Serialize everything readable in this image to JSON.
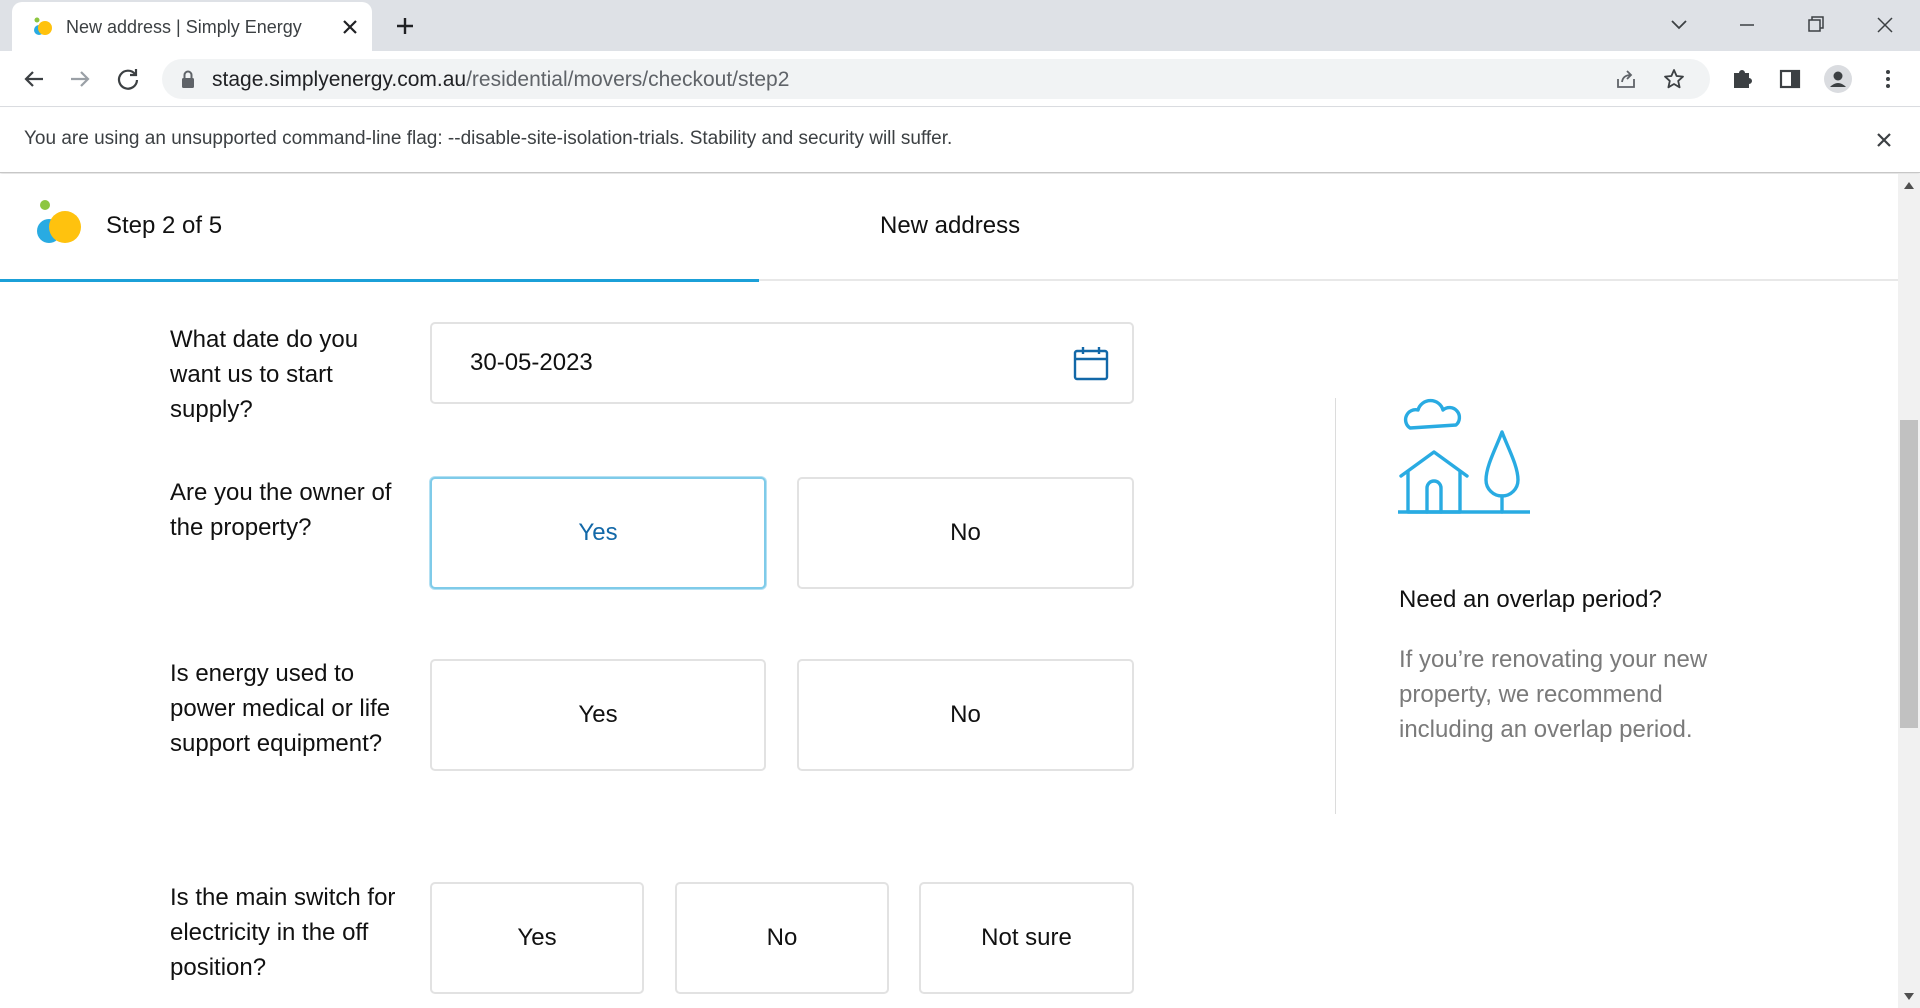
{
  "browser": {
    "tab_title": "New address | Simply Energy",
    "url_host": "stage.simplyenergy.com.au",
    "url_path": "/residential/movers/checkout/step2",
    "infobar_message": "You are using an unsupported command-line flag: --disable-site-isolation-trials. Stability and security will suffer."
  },
  "header": {
    "step_label": "Step 2 of 5",
    "step_title": "New address",
    "progress_fraction": 0.4,
    "accent_color": "#1ba0d8"
  },
  "form": {
    "start_date": {
      "question": "What date do you want us to start supply?",
      "value": "30-05-2023"
    },
    "owner": {
      "question": "Are you the owner of the property?",
      "options": [
        "Yes",
        "No"
      ],
      "selected": "Yes"
    },
    "life_support": {
      "question": "Is energy used to power medical or life support equipment?",
      "options": [
        "Yes",
        "No"
      ]
    },
    "main_switch": {
      "question": "Is the main switch for electricity in the off position?",
      "options": [
        "Yes",
        "No",
        "Not sure"
      ]
    }
  },
  "sidebar": {
    "title": "Need an overlap period?",
    "text": "If you’re renovating your new property, we recommend including an overlap period."
  }
}
